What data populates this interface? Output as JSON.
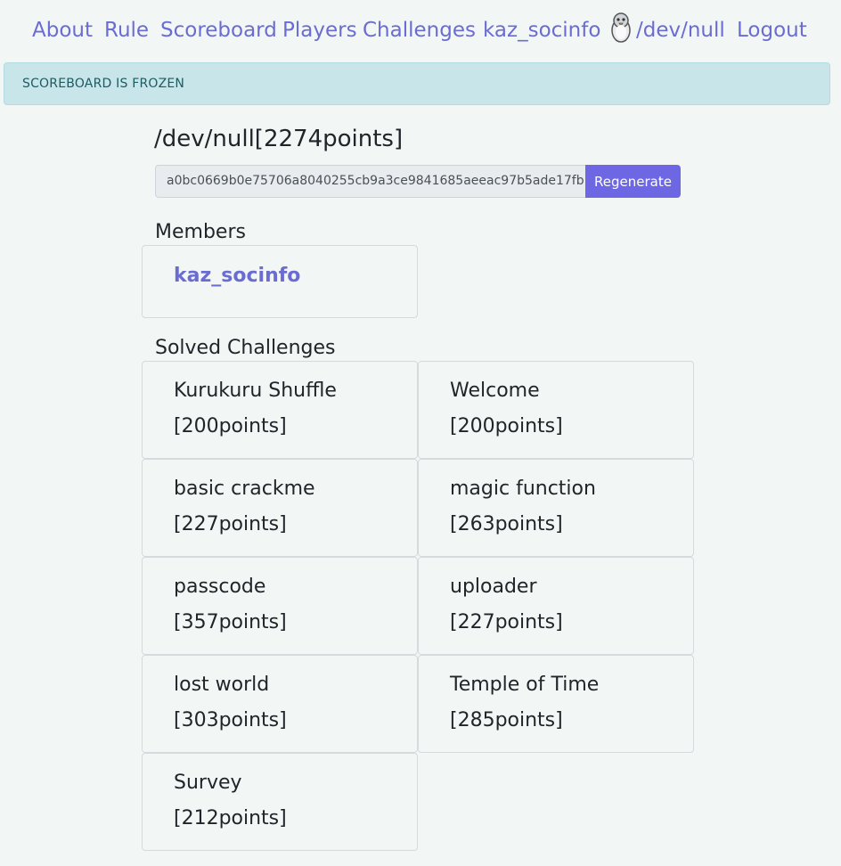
{
  "nav": {
    "items": [
      "About",
      "Rule",
      "Scoreboard",
      "Players",
      "Challenges",
      "kaz_socinfo"
    ],
    "team_name": "/dev/null",
    "team_icon": "penguin-icon",
    "logout": "Logout"
  },
  "alert": {
    "text": "SCOREBOARD IS FROZEN"
  },
  "team": {
    "title": "/dev/null[2274points]",
    "token": "a0bc0669b0e75706a8040255cb9a3ce9841685aeeac97b5ade17fb",
    "regenerate_label": "Regenerate"
  },
  "members": {
    "heading": "Members",
    "list": [
      "kaz_socinfo"
    ]
  },
  "solved": {
    "heading": "Solved Challenges",
    "challenges": [
      {
        "name": "Kurukuru Shuffle",
        "points": "[200points]"
      },
      {
        "name": "Welcome",
        "points": "[200points]"
      },
      {
        "name": "basic crackme",
        "points": "[227points]"
      },
      {
        "name": "magic function",
        "points": "[263points]"
      },
      {
        "name": "passcode",
        "points": "[357points]"
      },
      {
        "name": "uploader",
        "points": "[227points]"
      },
      {
        "name": "lost world",
        "points": "[303points]"
      },
      {
        "name": "Temple of Time",
        "points": "[285points]"
      },
      {
        "name": "Survey",
        "points": "[212points]"
      }
    ]
  },
  "colors": {
    "link": "#6b6cd1",
    "button": "#6d67e4",
    "alert_bg": "#c8e6e9",
    "page_bg": "#f2f7f6"
  }
}
